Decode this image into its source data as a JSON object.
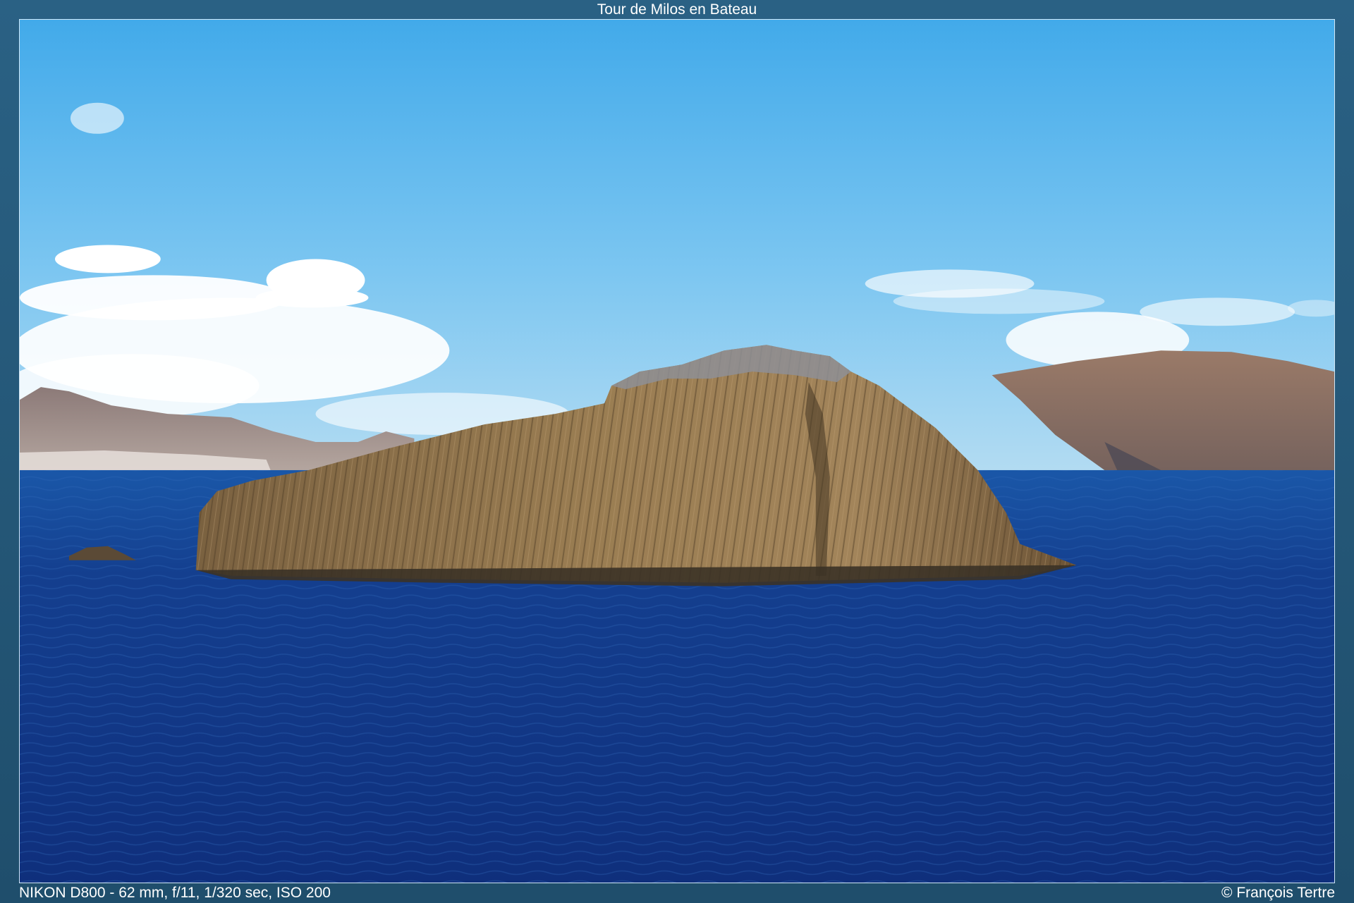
{
  "gallery": {
    "title": "Tour de Milos en Bateau",
    "exif": "NIKON D800 - 62 mm, f/11, 1/320 sec, ISO 200",
    "copyright": "© François Tertre"
  },
  "colors": {
    "frame": "#2a6184",
    "sky_top": "#4aaee9",
    "sky_bottom": "#a9d9f3",
    "sea": "#123f8c",
    "rock": "#8a7048"
  }
}
